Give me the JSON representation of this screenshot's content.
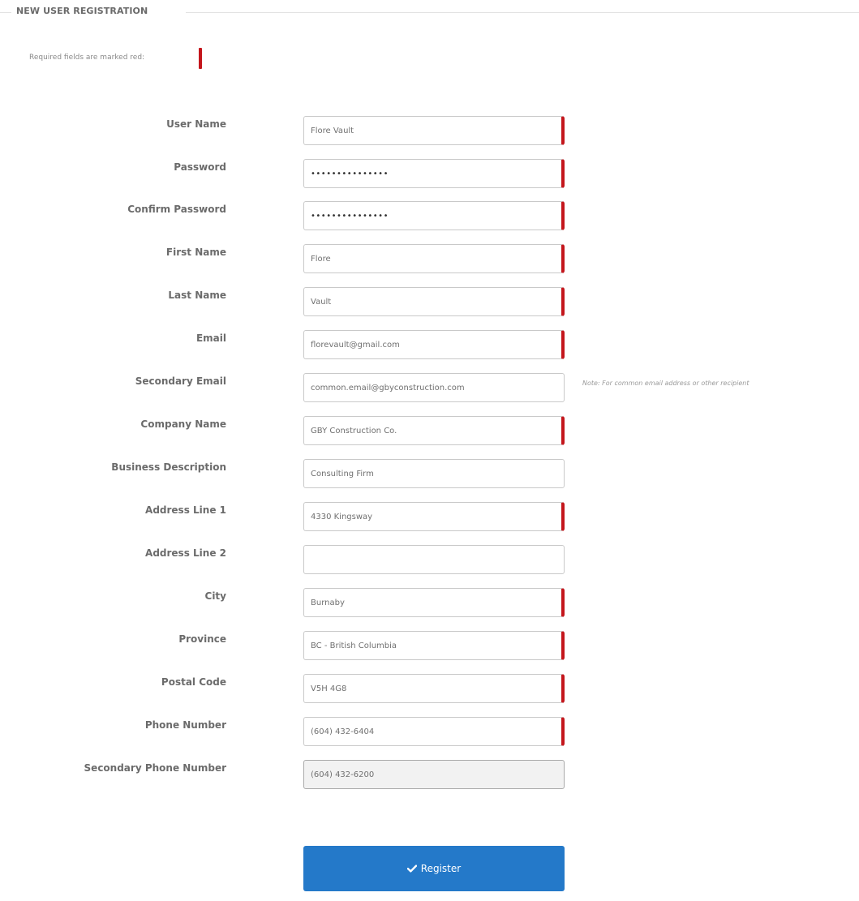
{
  "form": {
    "legend": "NEW USER REGISTRATION",
    "required_note": "Required fields are marked red:",
    "secondary_email_note": "Note: For common email address or other recipient",
    "register_label": "Register",
    "fields": {
      "user_name": {
        "label": "User Name",
        "value": "Flore Vault",
        "required": true
      },
      "password": {
        "label": "Password",
        "value": "•••••••••••••••",
        "required": true
      },
      "confirm_password": {
        "label": "Confirm Password",
        "value": "•••••••••••••••",
        "required": true
      },
      "first_name": {
        "label": "First Name",
        "value": "Flore",
        "required": true
      },
      "last_name": {
        "label": "Last Name",
        "value": "Vault",
        "required": true
      },
      "email": {
        "label": "Email",
        "value": "florevault@gmail.com",
        "required": true
      },
      "secondary_email": {
        "label": "Secondary Email",
        "value": "common.email@gbyconstruction.com",
        "required": false
      },
      "company_name": {
        "label": "Company Name",
        "value": "GBY Construction Co.",
        "required": true
      },
      "business_description": {
        "label": "Business Description",
        "value": "Consulting Firm",
        "required": false
      },
      "address_line_1": {
        "label": "Address Line 1",
        "value": "4330 Kingsway",
        "required": true
      },
      "address_line_2": {
        "label": "Address Line 2",
        "value": "",
        "required": false
      },
      "city": {
        "label": "City",
        "value": "Burnaby",
        "required": true
      },
      "province": {
        "label": "Province",
        "value": "BC - British Columbia",
        "required": true
      },
      "postal_code": {
        "label": "Postal Code",
        "value": "V5H 4G8",
        "required": true
      },
      "phone_number": {
        "label": "Phone Number",
        "value": "(604) 432-6404",
        "required": true
      },
      "secondary_phone_number": {
        "label": "Secondary Phone Number",
        "value": "(604) 432-6200",
        "required": false
      }
    }
  },
  "colors": {
    "required_marker": "#c4161c",
    "button_bg": "#2479c9",
    "label_text": "#6b6b6b"
  },
  "icons": {
    "register_icon": "check-icon"
  }
}
